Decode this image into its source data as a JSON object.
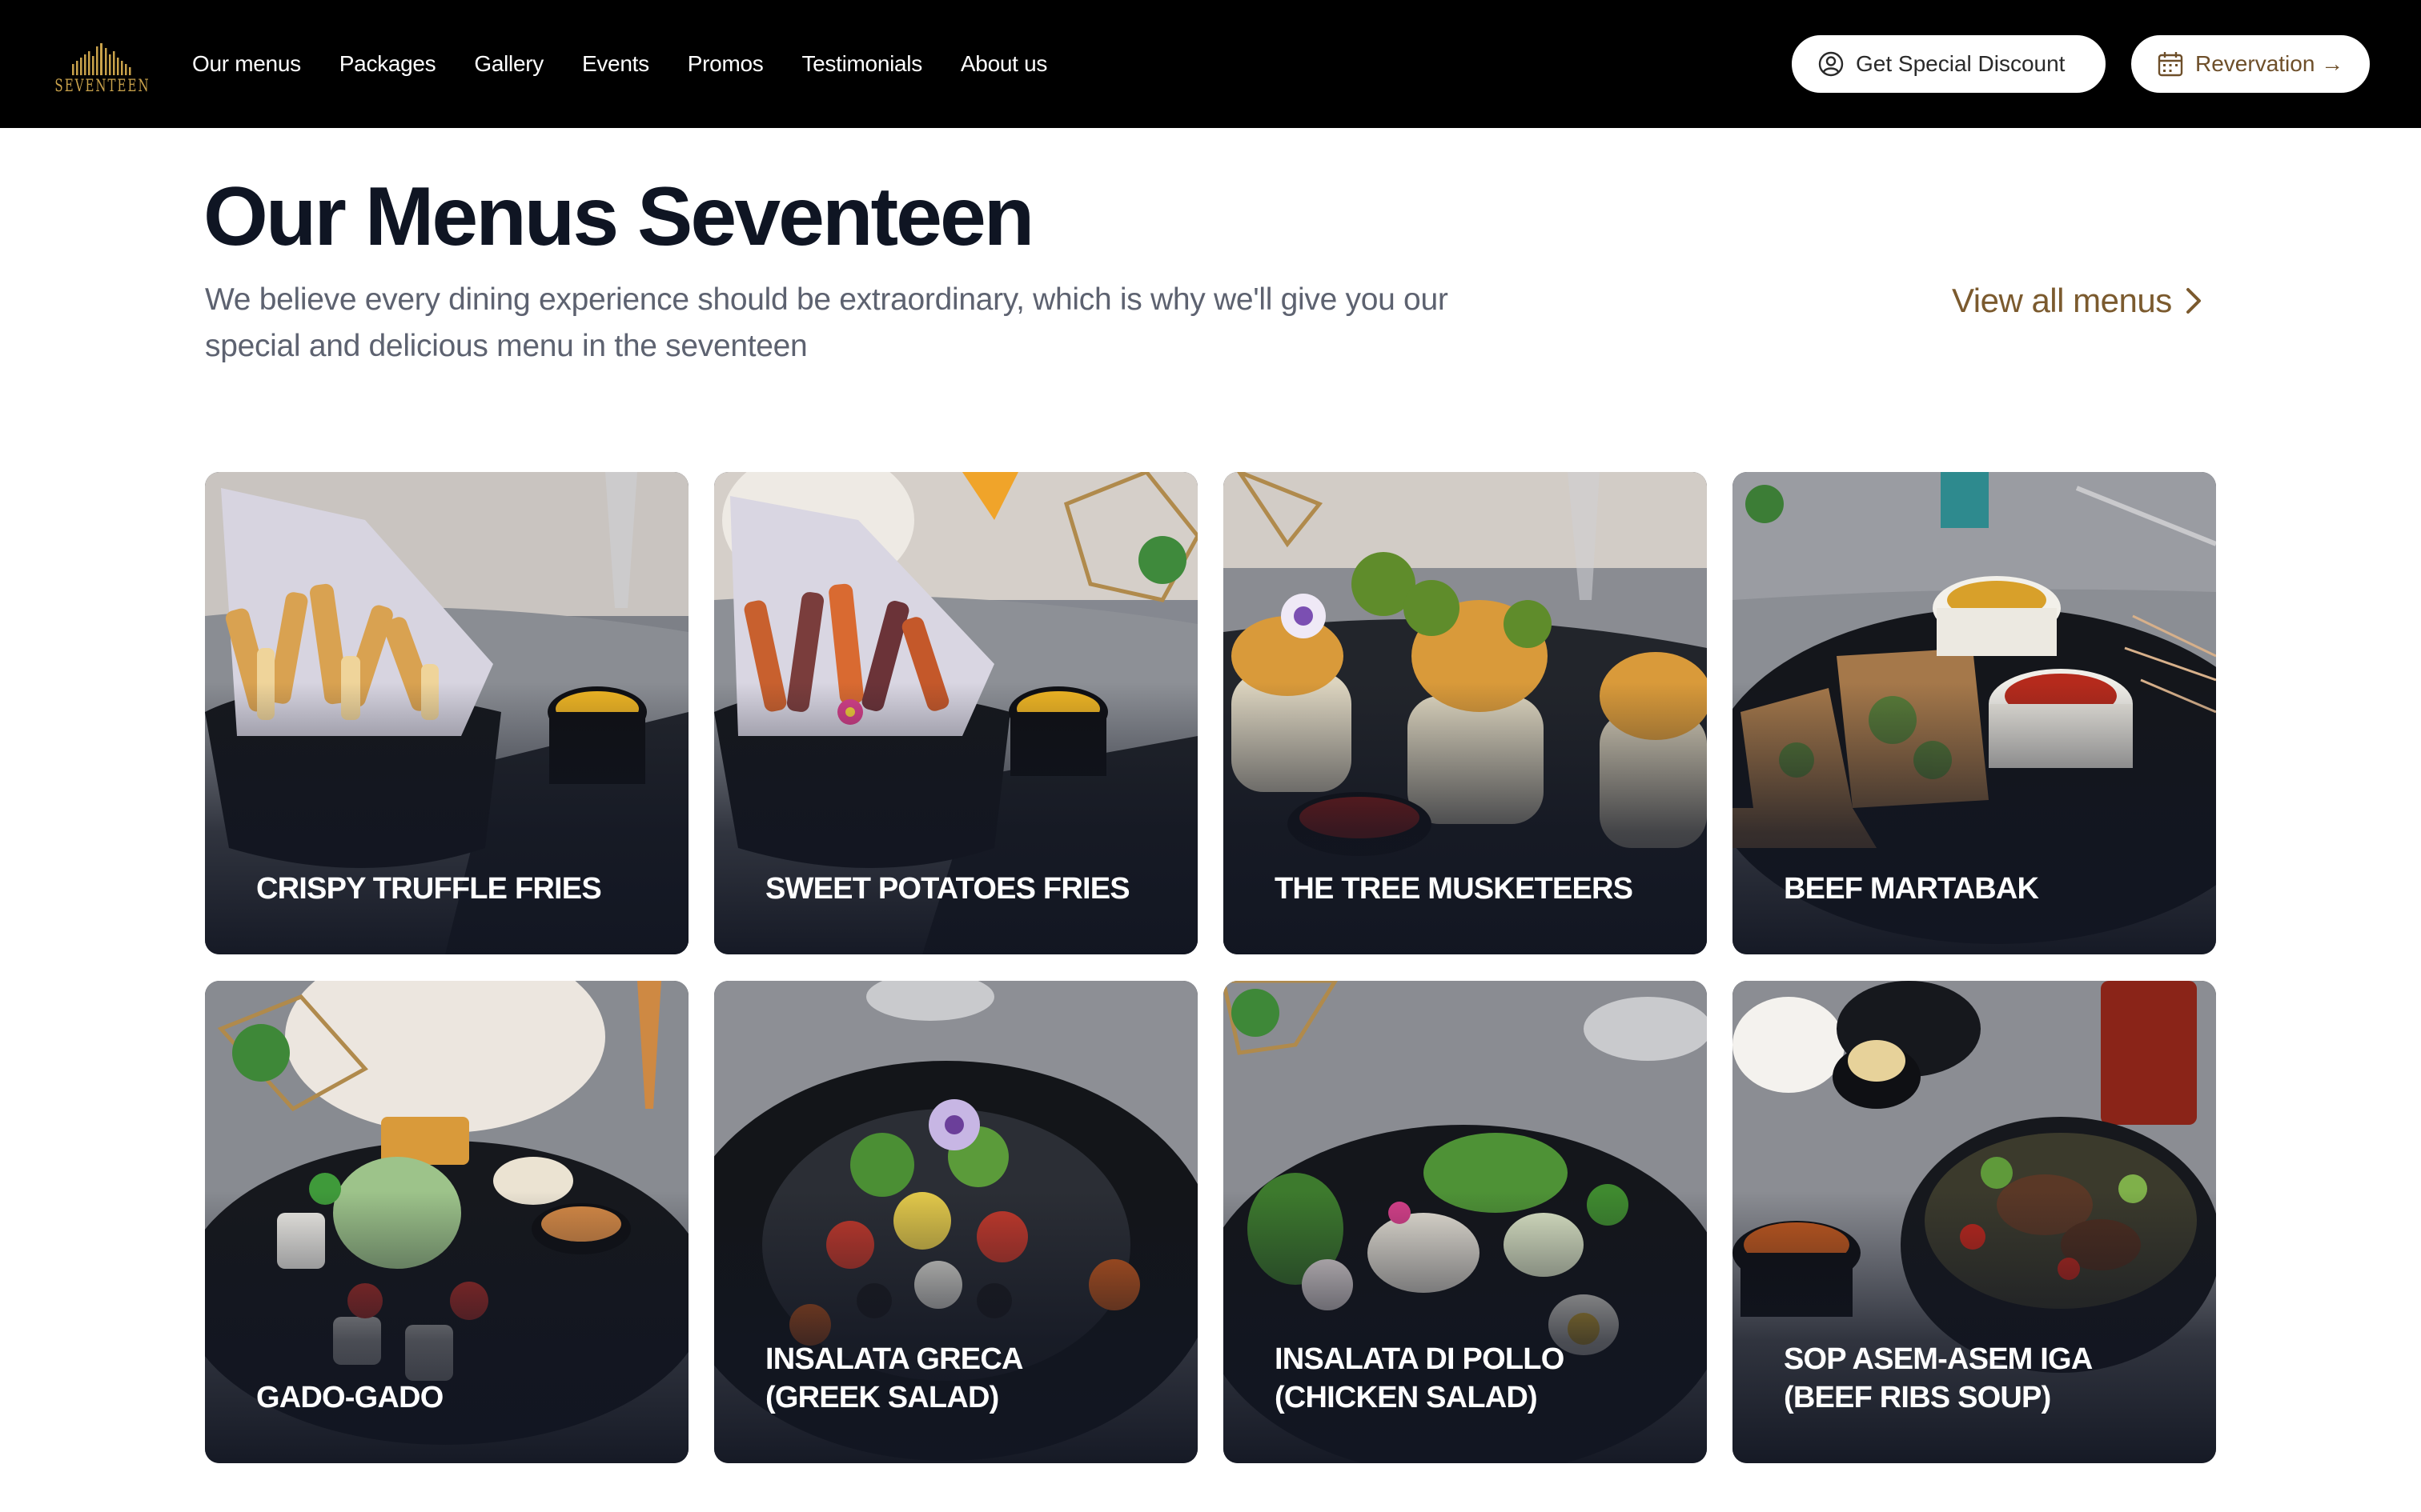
{
  "header": {
    "logo_text": "SEVENTEEN",
    "nav": [
      {
        "label": "Our menus"
      },
      {
        "label": "Packages"
      },
      {
        "label": "Gallery"
      },
      {
        "label": "Events"
      },
      {
        "label": "Promos"
      },
      {
        "label": "Testimonials"
      },
      {
        "label": "About us"
      }
    ],
    "discount_button": {
      "label": "Get Special Discount",
      "icon": "user-circle-icon"
    },
    "reservation_button": {
      "label": "Revervation →",
      "icon": "calendar-icon"
    }
  },
  "section": {
    "title": "Our Menus Seventeen",
    "description": "We believe every dining experience should be extraordinary, which is why we'll give you our special and delicious menu in the seventeen",
    "view_all": "View all menus"
  },
  "menus": [
    {
      "name": "CRISPY TRUFFLE FRIES"
    },
    {
      "name": "SWEET POTATOES FRIES"
    },
    {
      "name": "THE TREE MUSKETEERS"
    },
    {
      "name": "BEEF MARTABAK"
    },
    {
      "name": "GADO-GADO"
    },
    {
      "name": "INSALATA GRECA (GREEK SALAD)"
    },
    {
      "name": "INSALATA DI POLLO (CHICKEN SALAD)"
    },
    {
      "name": "SOP ASEM-ASEM IGA (BEEF RIBS SOUP)"
    }
  ],
  "colors": {
    "header_bg": "#000000",
    "accent_gold": "#c9a24b",
    "link_brown": "#7b5a2e",
    "title": "#0f1523",
    "card_overlay": "#121622"
  }
}
